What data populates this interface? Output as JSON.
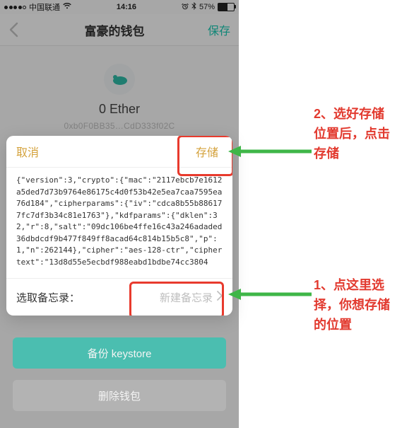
{
  "statusbar": {
    "carrier": "中国联通",
    "time": "14:16",
    "battery_percent": "57%"
  },
  "nav": {
    "title": "富豪的钱包",
    "save": "保存"
  },
  "hero": {
    "balance": "0 Ether",
    "address": "0xb0F0BB35…CdD333f02C"
  },
  "sheet": {
    "cancel": "取消",
    "store": "存储",
    "json_text": "{\"version\":3,\"crypto\":{\"mac\":\"2117ebcb7e1612a5ded7d73b9764e86175c4d0f53b42e5ea7caa7595ea76d184\",\"cipherparams\":{\"iv\":\"cdca8b55b886177fc7df3b34c81e1763\"},\"kdfparams\":{\"dklen\":32,\"r\":8,\"salt\":\"09dc106be4ffe16c43a246adaded36dbdcdf9b477f849ff8acad64c814b15b5c8\",\"p\":1,\"n\":262144},\"cipher\":\"aes-128-ctr\",\"ciphertext\":\"13d8d55e5ecbdf988eabd1bdbe74cc3804",
    "memo_label": "选取备忘录：",
    "memo_value": "新建备忘录"
  },
  "buttons": {
    "backup": "备份 keystore",
    "delete": "删除钱包"
  },
  "annotations": {
    "a2": "2、选好存储\n位置后，点击\n存储",
    "a1": "1、点这里选\n择，你想存储\n的位置"
  }
}
